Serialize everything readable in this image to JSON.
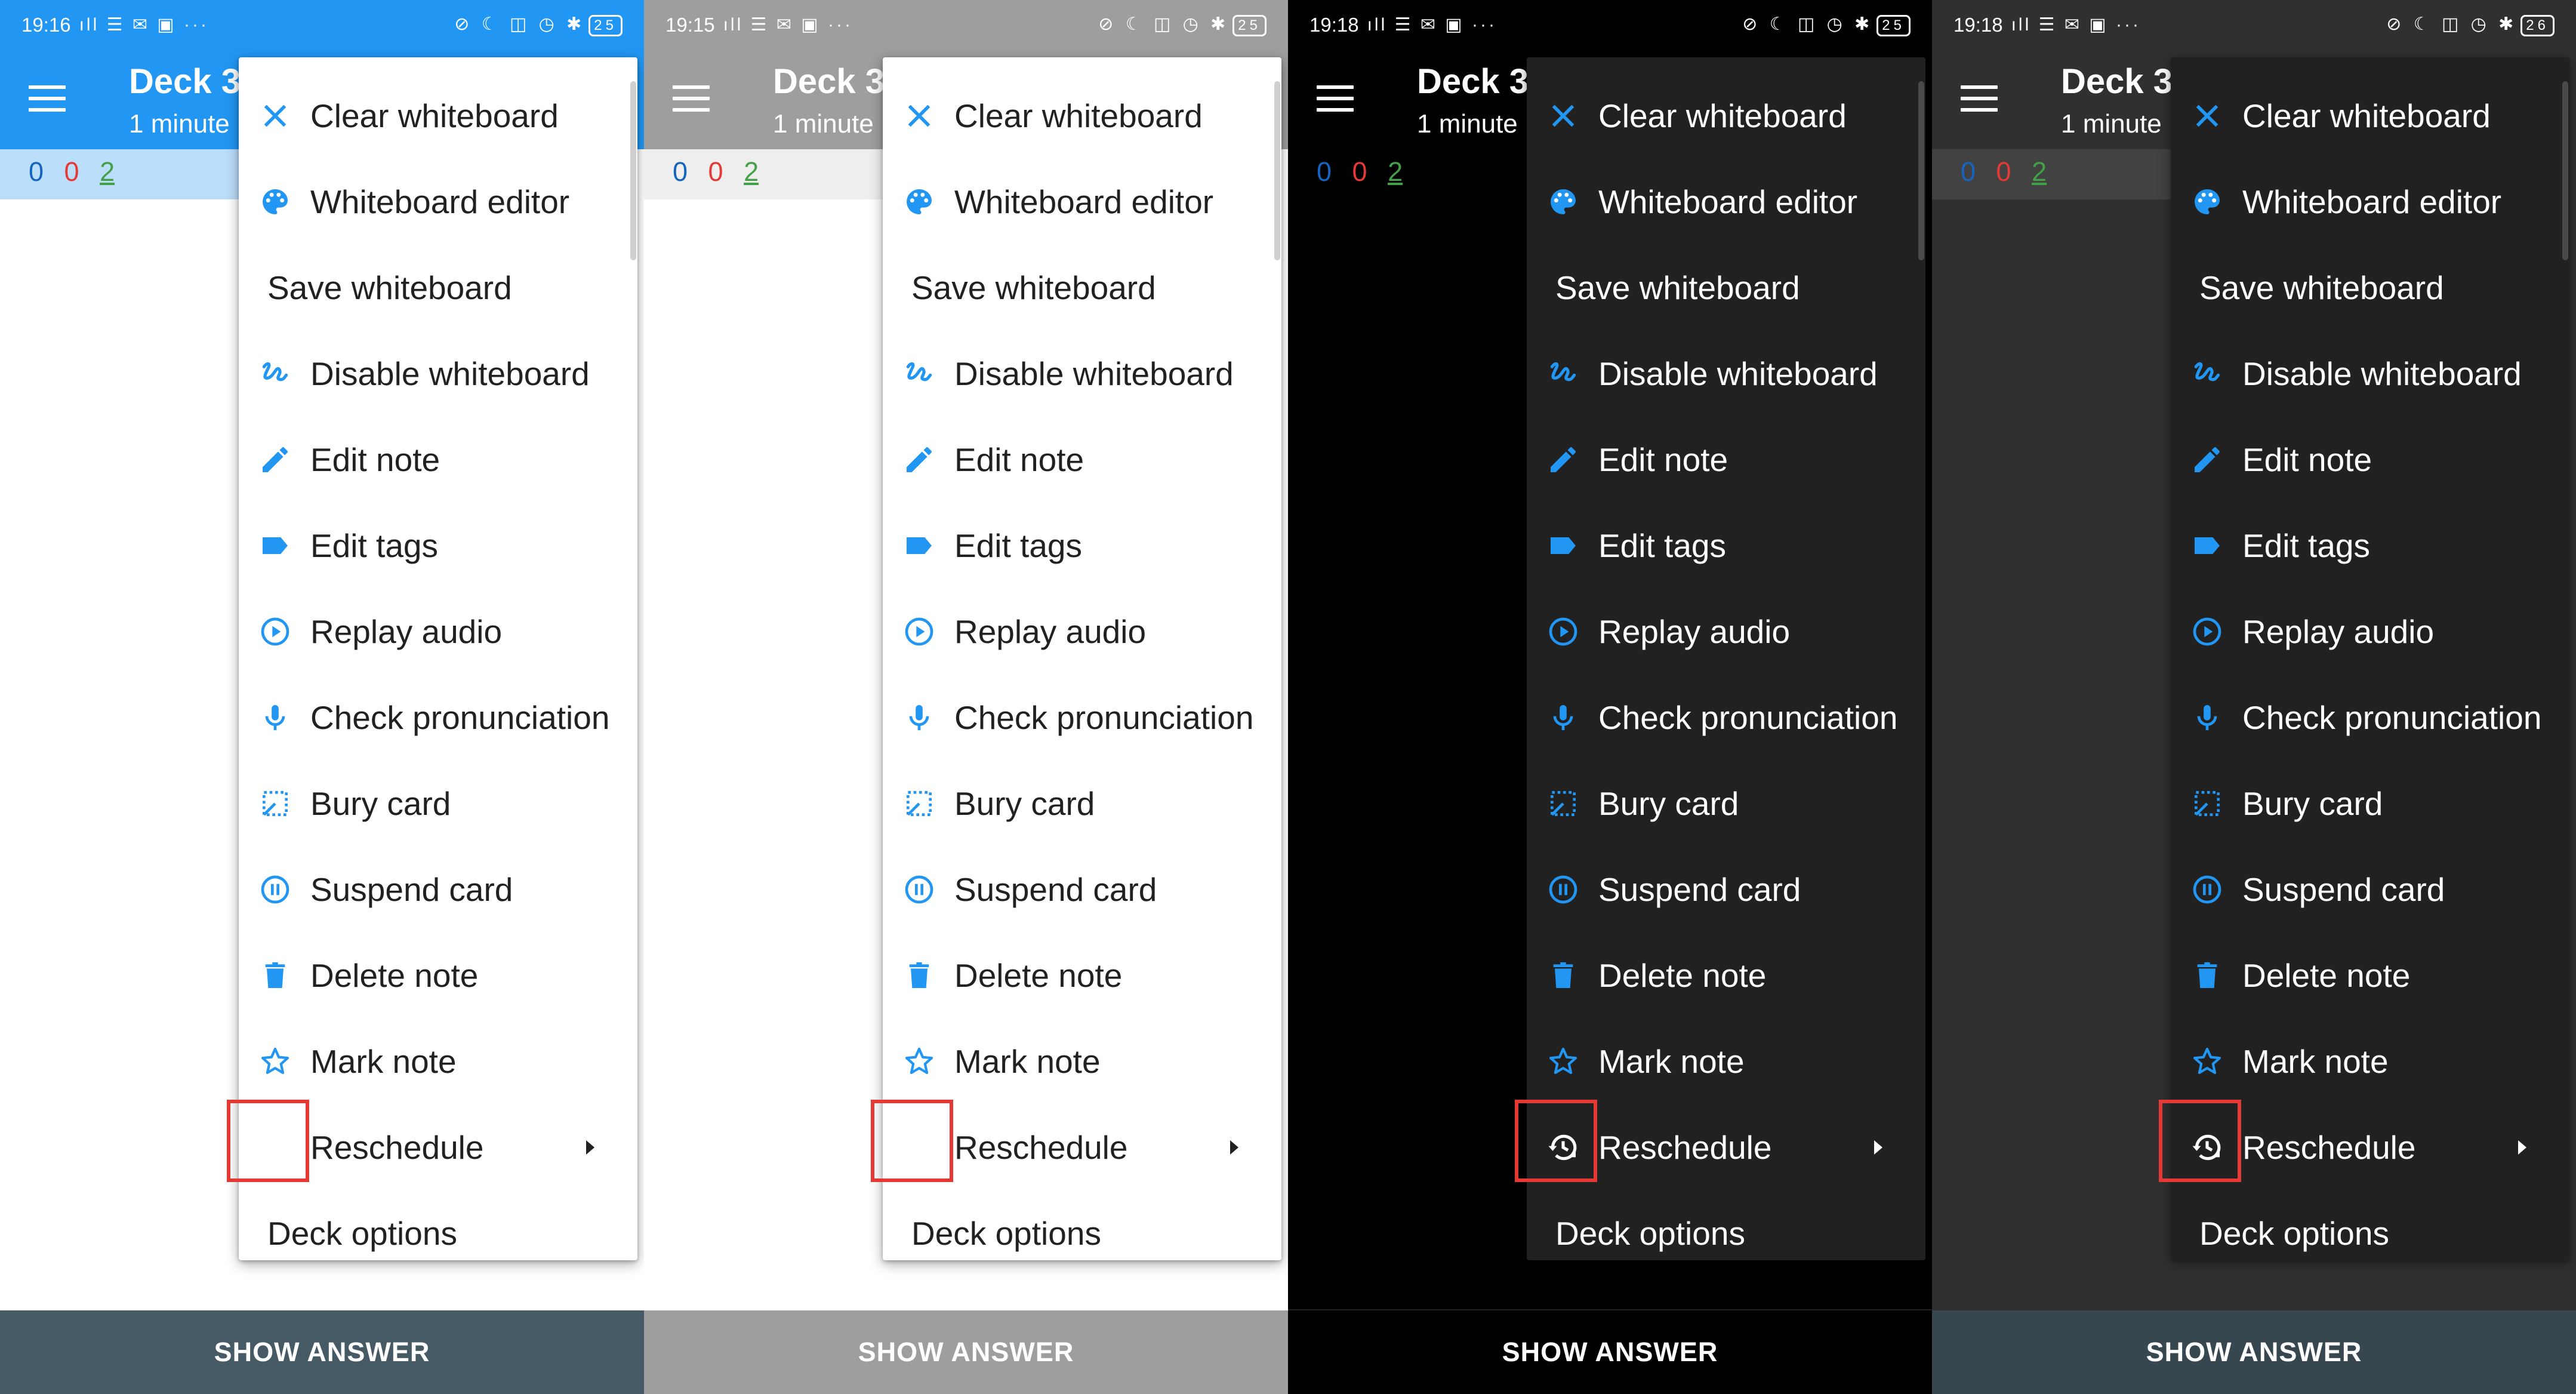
{
  "panels": [
    {
      "theme": "light blue",
      "status": {
        "time": "19:16",
        "battery": "25"
      },
      "toolbar": {
        "title": "Deck 3",
        "subtitle": "1 minute"
      },
      "counts": {
        "new": "0",
        "learn": "0",
        "review": "2"
      },
      "show_answer": "SHOW ANSWER",
      "reschedule_icon_visible": false
    },
    {
      "theme": "light grey",
      "status": {
        "time": "19:15",
        "battery": "25"
      },
      "toolbar": {
        "title": "Deck 3",
        "subtitle": "1 minute"
      },
      "counts": {
        "new": "0",
        "learn": "0",
        "review": "2"
      },
      "show_answer": "SHOW ANSWER",
      "reschedule_icon_visible": false
    },
    {
      "theme": "black",
      "status": {
        "time": "19:18",
        "battery": "25"
      },
      "toolbar": {
        "title": "Deck 3",
        "subtitle": "1 minute"
      },
      "counts": {
        "new": "0",
        "learn": "0",
        "review": "2"
      },
      "show_answer": "SHOW ANSWER",
      "reschedule_icon_visible": true
    },
    {
      "theme": "dark",
      "status": {
        "time": "19:18",
        "battery": "26"
      },
      "toolbar": {
        "title": "Deck 3",
        "subtitle": "1 minute"
      },
      "counts": {
        "new": "0",
        "learn": "0",
        "review": "2"
      },
      "show_answer": "SHOW ANSWER",
      "reschedule_icon_visible": true
    }
  ],
  "menu": {
    "items": [
      {
        "label": "Clear whiteboard",
        "icon": "close-icon"
      },
      {
        "label": "Whiteboard editor",
        "icon": "palette-icon"
      },
      {
        "label": "Save whiteboard",
        "icon": ""
      },
      {
        "label": "Disable whiteboard",
        "icon": "gesture-icon"
      },
      {
        "label": "Edit note",
        "icon": "pencil-icon"
      },
      {
        "label": "Edit tags",
        "icon": "tag-icon"
      },
      {
        "label": "Replay audio",
        "icon": "play-circle-icon"
      },
      {
        "label": "Check pronunciation",
        "icon": "microphone-icon"
      },
      {
        "label": "Bury card",
        "icon": "bury-icon"
      },
      {
        "label": "Suspend card",
        "icon": "pause-circle-icon"
      },
      {
        "label": "Delete note",
        "icon": "trash-icon"
      },
      {
        "label": "Mark note",
        "icon": "star-outline-icon"
      },
      {
        "label": "Reschedule",
        "icon": "history-icon"
      },
      {
        "label": "Deck options",
        "icon": ""
      }
    ]
  },
  "colors": {
    "accent": "#2196f3",
    "count_new": "#1565c0",
    "count_learn": "#e53935",
    "count_review": "#43a047",
    "highlight_box": "#e53935"
  }
}
